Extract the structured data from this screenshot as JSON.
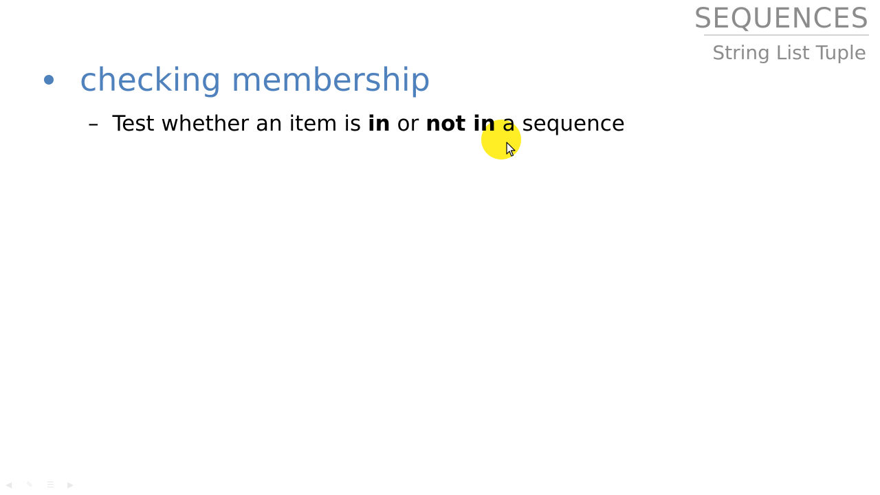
{
  "header": {
    "title": "SEQUENCES",
    "subtitle": "String List Tuple"
  },
  "content": {
    "bullet": "checking membership",
    "sub_bullet": {
      "dash": "–",
      "parts": [
        "Test whether an item is ",
        "in",
        " or ",
        "not in",
        " a sequence"
      ]
    }
  },
  "colors": {
    "bullet_blue": "#4f81bd",
    "header_gray": "#8c8c8c",
    "highlight_yellow": "#ffeb00"
  },
  "icons": {
    "pointer": "mouse-pointer-icon",
    "nav": [
      "previous-slide-icon",
      "pen-icon",
      "menu-icon",
      "next-slide-icon"
    ]
  }
}
